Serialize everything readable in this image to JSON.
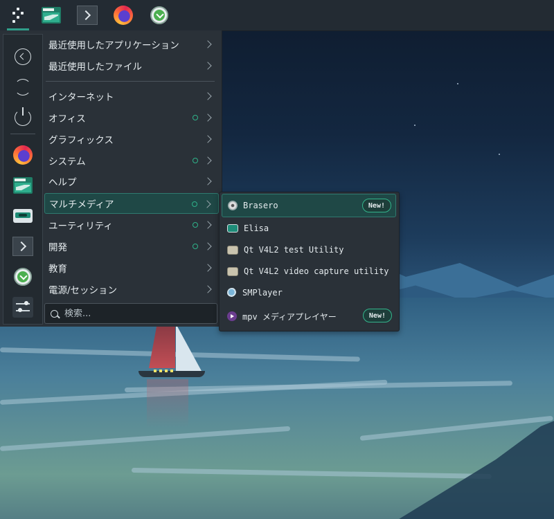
{
  "panel": {
    "items": [
      {
        "icon": "launcher-icon",
        "active": true
      },
      {
        "icon": "files-icon"
      },
      {
        "icon": "terminal-icon"
      },
      {
        "icon": "firefox-icon"
      },
      {
        "icon": "download-icon"
      }
    ]
  },
  "sidebar": {
    "items": [
      {
        "icon": "back-icon"
      },
      {
        "icon": "refresh-icon"
      },
      {
        "icon": "power-icon"
      },
      {
        "icon": "firefox-icon"
      },
      {
        "icon": "files-icon"
      },
      {
        "icon": "cassette-icon"
      },
      {
        "icon": "terminal-icon"
      },
      {
        "icon": "download-icon"
      },
      {
        "icon": "settings-icon"
      }
    ]
  },
  "menu": {
    "recent": [
      {
        "label": "最近使用したアプリケーション"
      },
      {
        "label": "最近使用したファイル"
      }
    ],
    "categories": [
      {
        "label": "インターネット",
        "new": false
      },
      {
        "label": "オフィス",
        "new": true
      },
      {
        "label": "グラフィックス",
        "new": false
      },
      {
        "label": "システム",
        "new": true
      },
      {
        "label": "ヘルプ",
        "new": false
      },
      {
        "label": "マルチメディア",
        "new": true,
        "selected": true
      },
      {
        "label": "ユーティリティ",
        "new": true
      },
      {
        "label": "開発",
        "new": true
      },
      {
        "label": "教育",
        "new": false
      },
      {
        "label": "電源/セッション",
        "new": false
      }
    ],
    "search": {
      "placeholder": "検索...",
      "value": ""
    }
  },
  "submenu": {
    "items": [
      {
        "label": "Brasero",
        "icon": "brasero-icon",
        "badge": "New!",
        "selected": true
      },
      {
        "label": "Elisa",
        "icon": "elisa-icon"
      },
      {
        "label": "Qt V4L2 test Utility",
        "icon": "qt-v4l2-icon"
      },
      {
        "label": "Qt V4L2 video capture utility",
        "icon": "qt-v4l2-icon"
      },
      {
        "label": "SMPlayer",
        "icon": "smplayer-icon"
      },
      {
        "label": "mpv メディアプレイヤー",
        "icon": "mpv-icon",
        "badge": "New!"
      }
    ]
  },
  "colors": {
    "accent": "#2f9e8a",
    "selection_bg": "#1f4846",
    "new_indicator": "#2fb38a",
    "menu_bg": "#2a3138"
  }
}
